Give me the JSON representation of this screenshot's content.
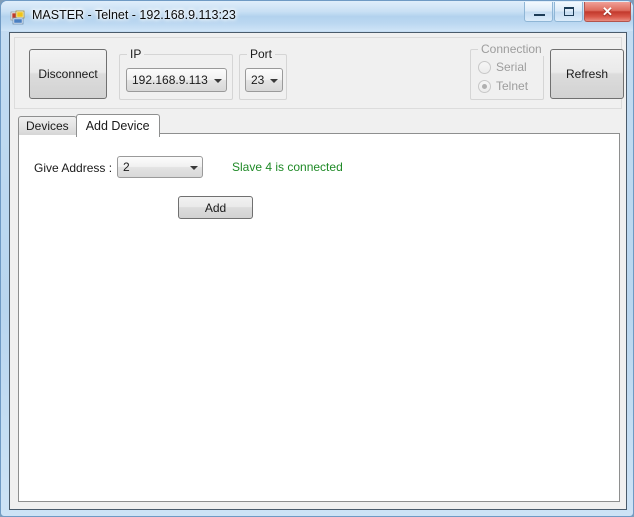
{
  "window": {
    "title": "MASTER - Telnet - 192.168.9.113:23",
    "icon": "winforms-app-icon",
    "controls": {
      "minimize": "minimize-icon",
      "maximize": "maximize-icon",
      "close": "✕"
    }
  },
  "toolbar": {
    "disconnect_label": "Disconnect",
    "refresh_label": "Refresh",
    "ip_group": {
      "label": "IP",
      "selected": "192.168.9.113"
    },
    "port_group": {
      "label": "Port",
      "selected": "23"
    },
    "connection_group": {
      "label": "Connection",
      "enabled": false,
      "options": [
        {
          "label": "Serial",
          "selected": false
        },
        {
          "label": "Telnet",
          "selected": true
        }
      ]
    }
  },
  "tabs": [
    {
      "label": "Devices",
      "active": false
    },
    {
      "label": "Add Device",
      "active": true
    }
  ],
  "add_device_page": {
    "address_label": "Give Address :",
    "address_value": "2",
    "status_message": "Slave 4 is connected",
    "status_color": "#1f8a27",
    "add_button_label": "Add"
  }
}
